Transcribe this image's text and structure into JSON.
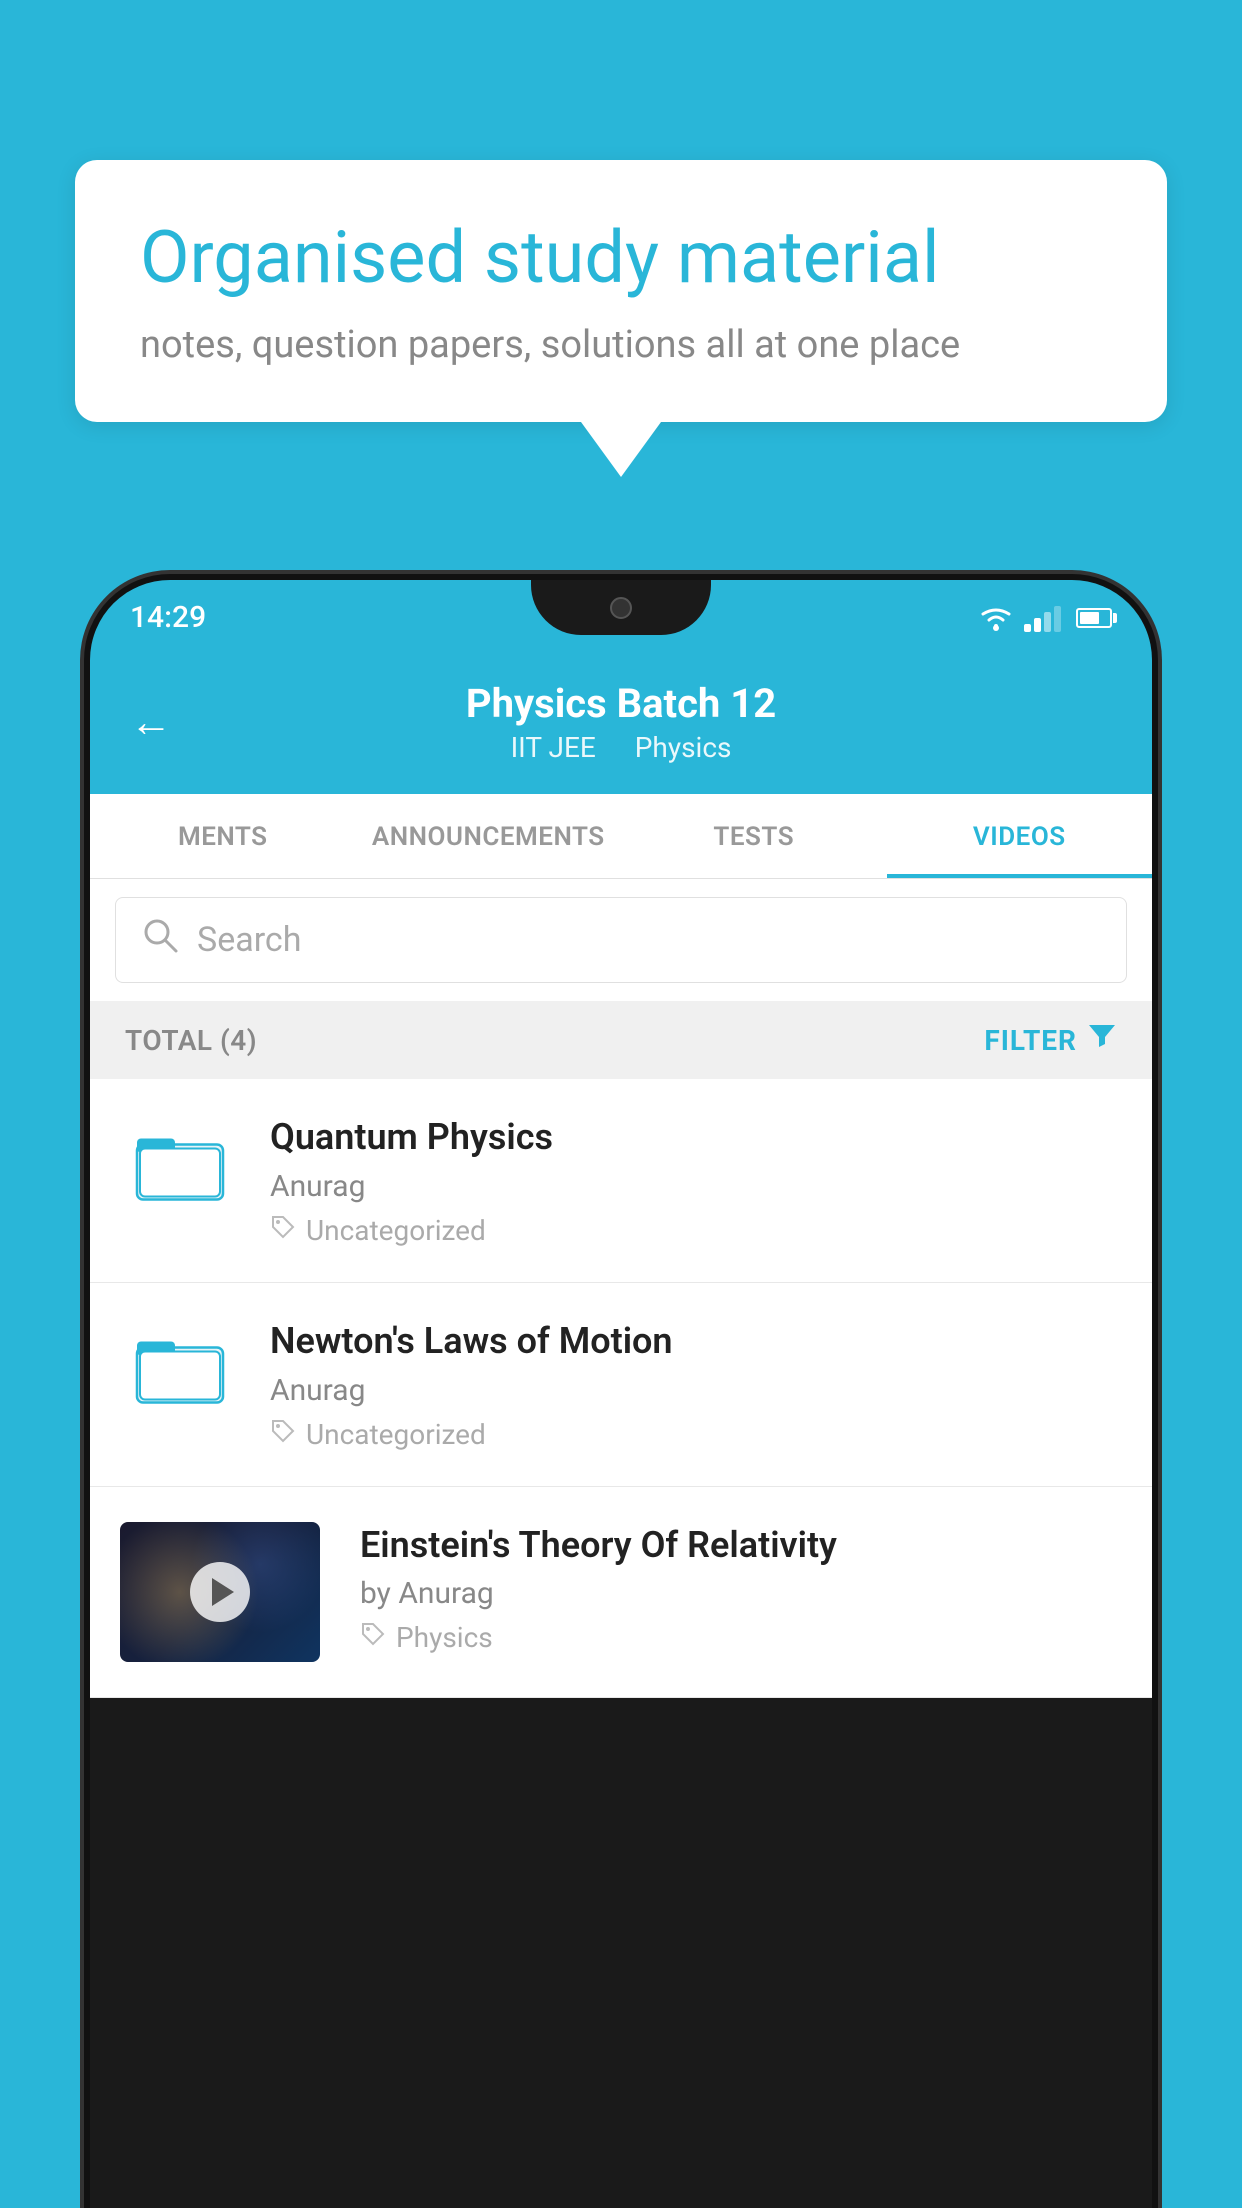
{
  "background_color": "#29b6d8",
  "speech_bubble": {
    "title": "Organised study material",
    "subtitle": "notes, question papers, solutions all at one place"
  },
  "status_bar": {
    "time": "14:29"
  },
  "app_header": {
    "title": "Physics Batch 12",
    "subtitle_part1": "IIT JEE",
    "subtitle_part2": "Physics",
    "back_label": "←"
  },
  "tabs": [
    {
      "label": "MENTS",
      "active": false
    },
    {
      "label": "ANNOUNCEMENTS",
      "active": false
    },
    {
      "label": "TESTS",
      "active": false
    },
    {
      "label": "VIDEOS",
      "active": true
    }
  ],
  "search": {
    "placeholder": "Search"
  },
  "filter_bar": {
    "total_label": "TOTAL (4)",
    "filter_label": "FILTER"
  },
  "videos": [
    {
      "title": "Quantum Physics",
      "author": "Anurag",
      "tag": "Uncategorized",
      "type": "folder"
    },
    {
      "title": "Newton's Laws of Motion",
      "author": "Anurag",
      "tag": "Uncategorized",
      "type": "folder"
    },
    {
      "title": "Einstein's Theory Of Relativity",
      "author": "by Anurag",
      "tag": "Physics",
      "type": "video"
    }
  ]
}
